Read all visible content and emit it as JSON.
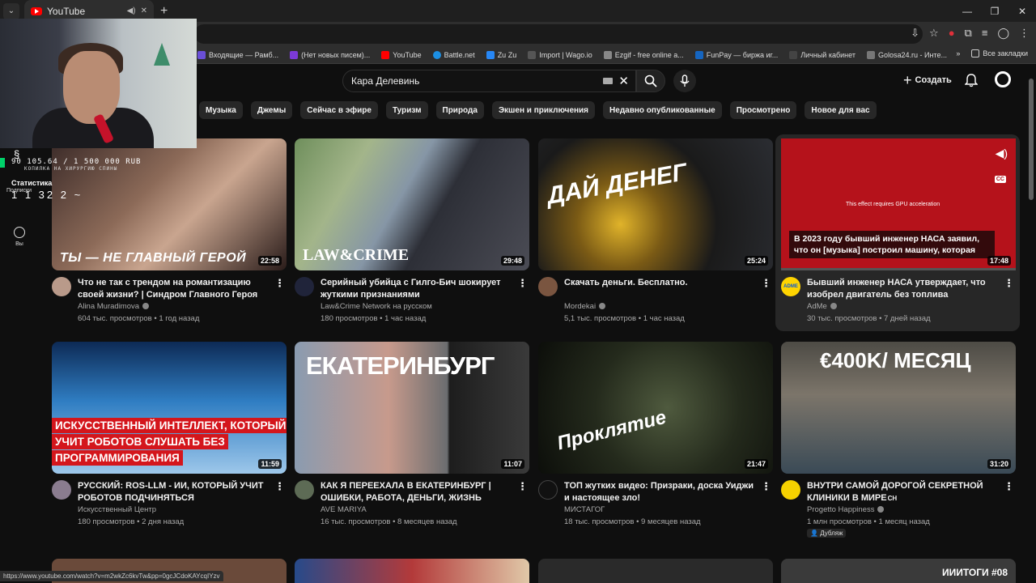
{
  "browser": {
    "tab_title": "YouTube",
    "bookmarks": [
      "Входящие — Рамб...",
      "(Нет новых писем)...",
      "YouTube",
      "Battle.net",
      "Zu Zu",
      "Import | Wago.io",
      "Ezgif - free online a...",
      "FunPay — биржа иг...",
      "Личный кабинет",
      "Golosa24.ru - Инте..."
    ],
    "bookmarks_all": "Все закладки",
    "status_url": "https://www.youtube.com/watch?v=m2wkZc6kvTw&pp=0gcJCdoKAYcqIYzv"
  },
  "header": {
    "search_value": "Кара Делевинь",
    "create_label": "Создать"
  },
  "chips": [
    "Музыка",
    "Джемы",
    "Сейчас в эфире",
    "Туризм",
    "Природа",
    "Экшен и приключения",
    "Недавно опубликованные",
    "Просмотрено",
    "Новое для вас"
  ],
  "overlay": {
    "money": "90 105.64 / 1 500 000 RUB",
    "money_sub": "КОПИЛКА НА ХИРУРГИЮ СПИНЫ",
    "stats_label": "Статистика",
    "stats_nums": "1 1 32 2 ~"
  },
  "sidebar": {
    "subscriptions": "Подписки",
    "you": "Вы"
  },
  "videos": [
    {
      "title": "Что не так с трендом на романтизацию своей жизни? | Синдром Главного Героя",
      "channel": "Alina Muradimova",
      "meta": "604 тыс. просмотров • 1 год назад",
      "duration": "22:58",
      "thumb_text": "ТЫ — НЕ ГЛАВНЫЙ ГЕРОЙ"
    },
    {
      "title": "Серийный убийца с Гилго-Бич шокирует жуткими признаниями",
      "channel": "Law&Crime Network на русском",
      "meta": "180 просмотров • 1 час назад",
      "duration": "29:48",
      "thumb_text": "LAW&CRIME"
    },
    {
      "title": "Скачать деньги. Бесплатно.",
      "channel": "Mordekai",
      "meta": "5,1 тыс. просмотров • 1 час назад",
      "duration": "25:24",
      "thumb_text": "ДАЙ ДЕНЕГ"
    },
    {
      "title": "Бывший инженер НАСА утверждает, что изобрел двигатель без топлива",
      "channel": "AdMe",
      "meta": "30 тыс. просмотров • 7 дней назад",
      "duration": "17:48",
      "thumb_text": "В 2023 году бывший инженер НАСА заявил, что он [музыка] построил машину, которая",
      "gpu_note": "This effect requires GPU acceleration",
      "cc": "CC"
    },
    {
      "title": "РУССКИЙ: ROS-LLM - ИИ, КОТОРЫЙ УЧИТ РОБОТОВ ПОДЧИНЯТЬСЯ",
      "channel": "Искусственный Центр",
      "meta": "180 просмотров • 2 дня назад",
      "duration": "11:59",
      "thumb_text": "ИСКУССТВЕННЫЙ ИНТЕЛЛЕКТ, КОТОРЫЙ УЧИТ РОБОТОВ СЛУШАТЬ БЕЗ ПРОГРАММИРОВАНИЯ"
    },
    {
      "title": "КАК Я ПЕРЕЕХАЛА В ЕКАТЕРИНБУРГ | ОШИБКИ, РАБОТА, ДЕНЬГИ, ЖИЗНЬ",
      "channel": "AVE MARIYA",
      "meta": "16 тыс. просмотров • 8 месяцев назад",
      "duration": "11:07",
      "thumb_text": "ЕКАТЕРИНБУРГ"
    },
    {
      "title": "ТОП жутких видео: Призраки, доска Уиджи и настоящее зло!",
      "channel": "МИСТАГОГ",
      "meta": "18 тыс. просмотров • 9 месяцев назад",
      "duration": "21:47",
      "thumb_text": "Проклятие"
    },
    {
      "title": "ВНУТРИ САМОЙ ДОРОГОЙ СЕКРЕТНОЙ КЛИНИКИ В МИРЕ",
      "title_suffix": "CH",
      "channel": "Progetto Happiness",
      "meta": "1 млн просмотров • 1 месяц назад",
      "duration": "31:20",
      "thumb_text": "€400K/ МЕСЯЦ",
      "badge": "Дубляж"
    }
  ],
  "row3_text": "ИИИТОГИ #08",
  "colors": {
    "bg": "#0f0f0f",
    "chip": "#272727",
    "accent": "#ff0000"
  }
}
